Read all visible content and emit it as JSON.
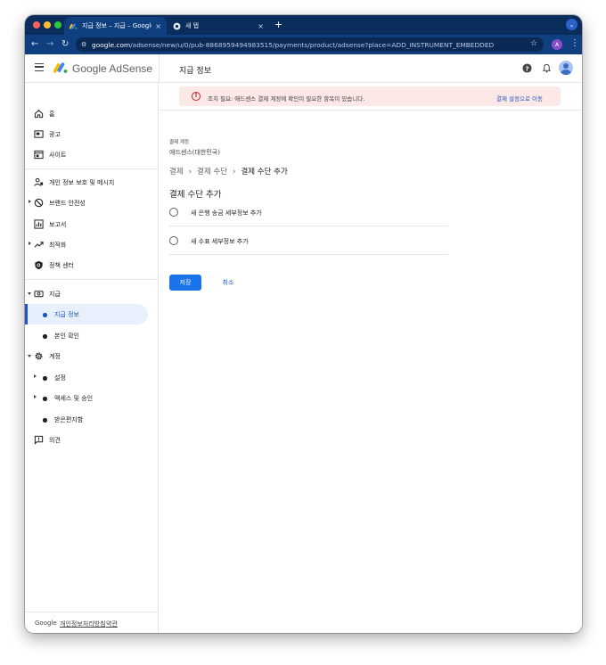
{
  "browser": {
    "tabs": [
      {
        "title": "지급 정보 – 지급 – Google AdSense",
        "close": "×",
        "icon": "adsense-favicon"
      },
      {
        "title": "새 탭",
        "close": "×",
        "icon": "chrome-favicon"
      }
    ],
    "new_tab": "+",
    "url_host": "google.com",
    "url_path": "/adsense/new/u/0/pub-8868959494983515/payments/product/adsense?place=ADD_INSTRUMENT_EMBEDDED",
    "profile_initial": "A"
  },
  "header": {
    "brand": "Google AdSense",
    "page_title": "지급 정보"
  },
  "sidebar": {
    "items": [
      {
        "label": "홈",
        "icon": "home-icon"
      },
      {
        "label": "광고",
        "icon": "ads-icon"
      },
      {
        "label": "사이트",
        "icon": "sites-icon"
      },
      {
        "label": "개인 정보 보호 및 메시지",
        "icon": "privacy-icon"
      },
      {
        "label": "브랜드 안전성",
        "icon": "block-icon"
      },
      {
        "label": "보고서",
        "icon": "reports-icon"
      },
      {
        "label": "최적화",
        "icon": "trending-icon"
      },
      {
        "label": "정책 센터",
        "icon": "policy-icon"
      },
      {
        "label": "지급",
        "icon": "payments-icon"
      },
      {
        "label": "지급 정보"
      },
      {
        "label": "본인 확인"
      },
      {
        "label": "계정",
        "icon": "gear-icon"
      },
      {
        "label": "설정"
      },
      {
        "label": "액세스 및 승인"
      },
      {
        "label": "받은편지함"
      },
      {
        "label": "의견",
        "icon": "feedback-icon"
      }
    ],
    "footer": {
      "google": "Google",
      "privacy": "개인정보처리방침",
      "terms": "약관"
    }
  },
  "main": {
    "alert": {
      "text": "조치 필요: 애드센스 결제 계정에 확인이 필요한 항목이 있습니다.",
      "link": "결제 설정으로 이동"
    },
    "account_label": "결제 계정",
    "account_name": "애드센스(대한민국)",
    "breadcrumb": [
      "결제",
      "결제 수단",
      "결제 수단 추가"
    ],
    "breadcrumb_sep": "›",
    "section_title": "결제 수단 추가",
    "options": [
      {
        "label": "새 은행 송금 세부정보 추가"
      },
      {
        "label": "새 수표 세부정보 추가"
      }
    ],
    "save_label": "저장",
    "cancel_label": "취소"
  },
  "colors": {
    "accent": "#1a73e8",
    "alert_bg": "#fce8e6",
    "alert_icon": "#c5221f",
    "active_nav_bg": "#e8f0fe",
    "browser_frame": "#0b2d5b"
  }
}
